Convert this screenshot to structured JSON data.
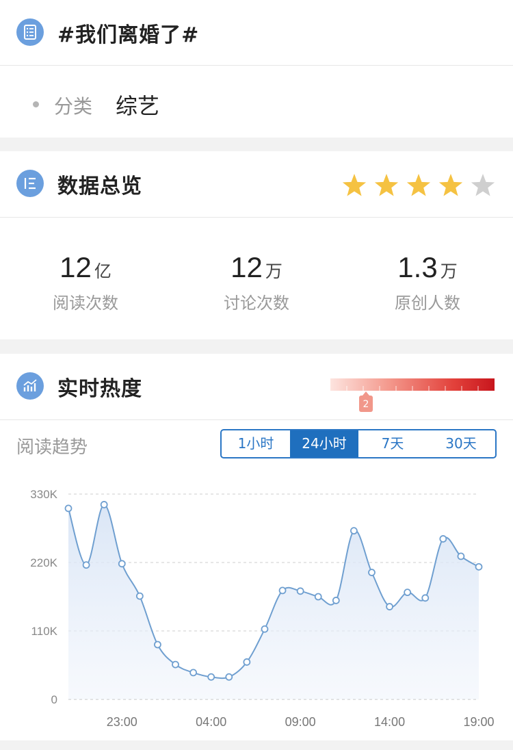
{
  "topic": {
    "title": "#我们离婚了#",
    "category_label": "分类",
    "category_value": "综艺"
  },
  "overview": {
    "title": "数据总览",
    "rating": 4,
    "rating_max": 5,
    "star_color": "#f5c242",
    "star_empty_color": "#cfcfcf",
    "stats": [
      {
        "value": "12",
        "unit": "亿",
        "label": "阅读次数"
      },
      {
        "value": "12",
        "unit": "万",
        "label": "讨论次数"
      },
      {
        "value": "1.3",
        "unit": "万",
        "label": "原创人数"
      }
    ]
  },
  "realtime": {
    "title": "实时热度",
    "heat_level": "2",
    "trend_label": "阅读趋势",
    "tabs": [
      "1小时",
      "24小时",
      "7天",
      "30天"
    ],
    "active_tab": "24小时",
    "accent_color": "#1f6fbe"
  },
  "chart_data": {
    "type": "area",
    "x_tick_labels": [
      "23:00",
      "04:00",
      "09:00",
      "14:00",
      "19:00"
    ],
    "y_tick_labels": [
      "0",
      "110K",
      "220K",
      "330K"
    ],
    "ylim": [
      0,
      330000
    ],
    "grid": true,
    "line_color": "#6f9fd0",
    "values": [
      307000,
      216000,
      313000,
      218000,
      166000,
      88000,
      56000,
      43000,
      36000,
      36000,
      60000,
      113000,
      175000,
      174000,
      165000,
      159000,
      271000,
      204000,
      149000,
      172000,
      163000,
      258000,
      230000,
      213000
    ]
  }
}
